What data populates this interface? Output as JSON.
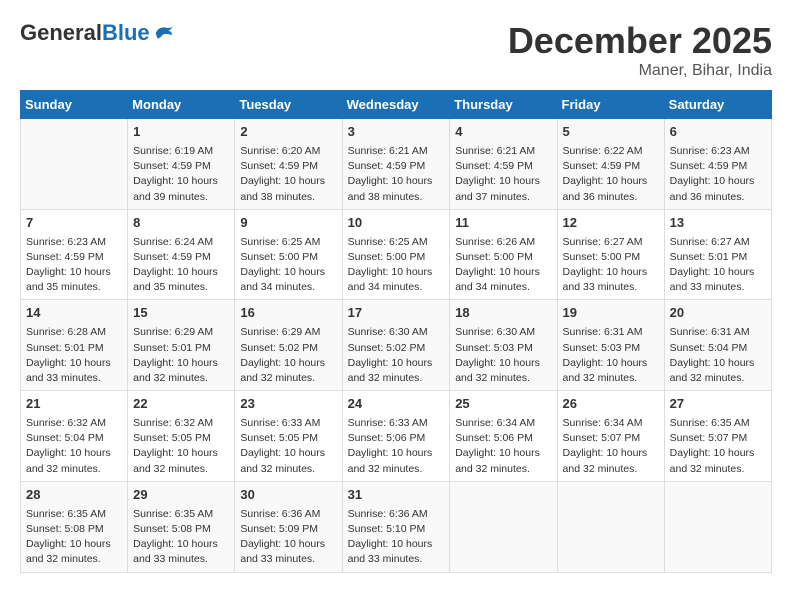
{
  "header": {
    "logo_general": "General",
    "logo_blue": "Blue",
    "title": "December 2025",
    "subtitle": "Maner, Bihar, India"
  },
  "days_of_week": [
    "Sunday",
    "Monday",
    "Tuesday",
    "Wednesday",
    "Thursday",
    "Friday",
    "Saturday"
  ],
  "weeks": [
    [
      {
        "day": "",
        "info": ""
      },
      {
        "day": "1",
        "info": "Sunrise: 6:19 AM\nSunset: 4:59 PM\nDaylight: 10 hours\nand 39 minutes."
      },
      {
        "day": "2",
        "info": "Sunrise: 6:20 AM\nSunset: 4:59 PM\nDaylight: 10 hours\nand 38 minutes."
      },
      {
        "day": "3",
        "info": "Sunrise: 6:21 AM\nSunset: 4:59 PM\nDaylight: 10 hours\nand 38 minutes."
      },
      {
        "day": "4",
        "info": "Sunrise: 6:21 AM\nSunset: 4:59 PM\nDaylight: 10 hours\nand 37 minutes."
      },
      {
        "day": "5",
        "info": "Sunrise: 6:22 AM\nSunset: 4:59 PM\nDaylight: 10 hours\nand 36 minutes."
      },
      {
        "day": "6",
        "info": "Sunrise: 6:23 AM\nSunset: 4:59 PM\nDaylight: 10 hours\nand 36 minutes."
      }
    ],
    [
      {
        "day": "7",
        "info": "Sunrise: 6:23 AM\nSunset: 4:59 PM\nDaylight: 10 hours\nand 35 minutes."
      },
      {
        "day": "8",
        "info": "Sunrise: 6:24 AM\nSunset: 4:59 PM\nDaylight: 10 hours\nand 35 minutes."
      },
      {
        "day": "9",
        "info": "Sunrise: 6:25 AM\nSunset: 5:00 PM\nDaylight: 10 hours\nand 34 minutes."
      },
      {
        "day": "10",
        "info": "Sunrise: 6:25 AM\nSunset: 5:00 PM\nDaylight: 10 hours\nand 34 minutes."
      },
      {
        "day": "11",
        "info": "Sunrise: 6:26 AM\nSunset: 5:00 PM\nDaylight: 10 hours\nand 34 minutes."
      },
      {
        "day": "12",
        "info": "Sunrise: 6:27 AM\nSunset: 5:00 PM\nDaylight: 10 hours\nand 33 minutes."
      },
      {
        "day": "13",
        "info": "Sunrise: 6:27 AM\nSunset: 5:01 PM\nDaylight: 10 hours\nand 33 minutes."
      }
    ],
    [
      {
        "day": "14",
        "info": "Sunrise: 6:28 AM\nSunset: 5:01 PM\nDaylight: 10 hours\nand 33 minutes."
      },
      {
        "day": "15",
        "info": "Sunrise: 6:29 AM\nSunset: 5:01 PM\nDaylight: 10 hours\nand 32 minutes."
      },
      {
        "day": "16",
        "info": "Sunrise: 6:29 AM\nSunset: 5:02 PM\nDaylight: 10 hours\nand 32 minutes."
      },
      {
        "day": "17",
        "info": "Sunrise: 6:30 AM\nSunset: 5:02 PM\nDaylight: 10 hours\nand 32 minutes."
      },
      {
        "day": "18",
        "info": "Sunrise: 6:30 AM\nSunset: 5:03 PM\nDaylight: 10 hours\nand 32 minutes."
      },
      {
        "day": "19",
        "info": "Sunrise: 6:31 AM\nSunset: 5:03 PM\nDaylight: 10 hours\nand 32 minutes."
      },
      {
        "day": "20",
        "info": "Sunrise: 6:31 AM\nSunset: 5:04 PM\nDaylight: 10 hours\nand 32 minutes."
      }
    ],
    [
      {
        "day": "21",
        "info": "Sunrise: 6:32 AM\nSunset: 5:04 PM\nDaylight: 10 hours\nand 32 minutes."
      },
      {
        "day": "22",
        "info": "Sunrise: 6:32 AM\nSunset: 5:05 PM\nDaylight: 10 hours\nand 32 minutes."
      },
      {
        "day": "23",
        "info": "Sunrise: 6:33 AM\nSunset: 5:05 PM\nDaylight: 10 hours\nand 32 minutes."
      },
      {
        "day": "24",
        "info": "Sunrise: 6:33 AM\nSunset: 5:06 PM\nDaylight: 10 hours\nand 32 minutes."
      },
      {
        "day": "25",
        "info": "Sunrise: 6:34 AM\nSunset: 5:06 PM\nDaylight: 10 hours\nand 32 minutes."
      },
      {
        "day": "26",
        "info": "Sunrise: 6:34 AM\nSunset: 5:07 PM\nDaylight: 10 hours\nand 32 minutes."
      },
      {
        "day": "27",
        "info": "Sunrise: 6:35 AM\nSunset: 5:07 PM\nDaylight: 10 hours\nand 32 minutes."
      }
    ],
    [
      {
        "day": "28",
        "info": "Sunrise: 6:35 AM\nSunset: 5:08 PM\nDaylight: 10 hours\nand 32 minutes."
      },
      {
        "day": "29",
        "info": "Sunrise: 6:35 AM\nSunset: 5:08 PM\nDaylight: 10 hours\nand 33 minutes."
      },
      {
        "day": "30",
        "info": "Sunrise: 6:36 AM\nSunset: 5:09 PM\nDaylight: 10 hours\nand 33 minutes."
      },
      {
        "day": "31",
        "info": "Sunrise: 6:36 AM\nSunset: 5:10 PM\nDaylight: 10 hours\nand 33 minutes."
      },
      {
        "day": "",
        "info": ""
      },
      {
        "day": "",
        "info": ""
      },
      {
        "day": "",
        "info": ""
      }
    ]
  ]
}
